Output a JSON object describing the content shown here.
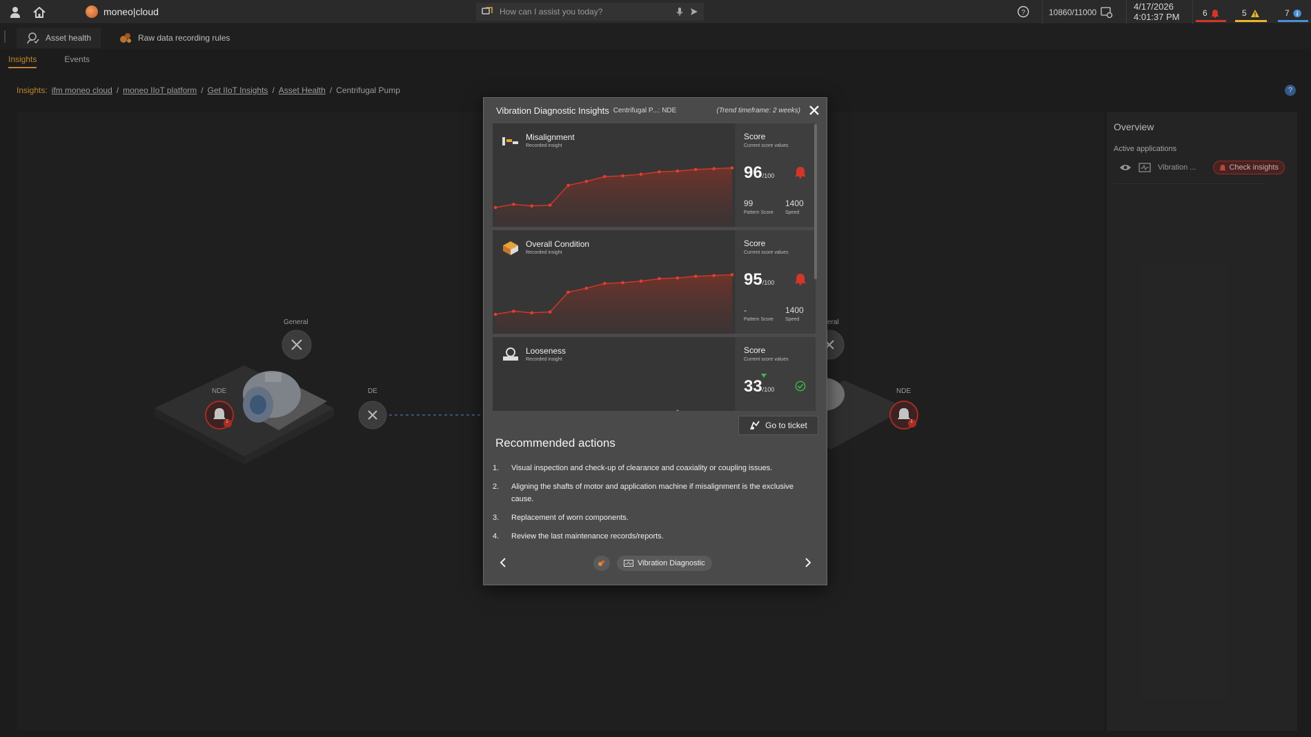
{
  "topbar": {
    "brand": "moneo|cloud",
    "assistant_placeholder": "How can I assist you today?",
    "counter": "10860/11000",
    "date": "4/17/2026",
    "time": "4:01:37 PM",
    "alerts": [
      {
        "count": "6",
        "type": "alarm",
        "color": "#d2362a"
      },
      {
        "count": "5",
        "type": "warning",
        "color": "#e8b82a"
      },
      {
        "count": "7",
        "type": "info",
        "color": "#4a8fd8"
      }
    ]
  },
  "apptabs": [
    {
      "label": "Asset health",
      "icon": "asset-health-icon"
    },
    {
      "label": "Raw data recording rules",
      "icon": "recording-rules-icon"
    }
  ],
  "subtabs": [
    {
      "label": "Insights",
      "active": true
    },
    {
      "label": "Events",
      "active": false
    }
  ],
  "breadcrumb": {
    "lead": "Insights:",
    "links": [
      "ifm moneo cloud",
      "moneo IIoT platform",
      "Get IIoT Insights",
      "Asset Health"
    ],
    "current": "Centrifugal Pump"
  },
  "diagram": {
    "general_label": "General",
    "general_label_right": "eral",
    "nde_left": "NDE",
    "de_left": "DE",
    "nde_right": "NDE",
    "badge_count": "1"
  },
  "overview": {
    "title": "Overview",
    "active_apps_label": "Active applications",
    "app_name": "Vibration ...",
    "check_button": "Check insights"
  },
  "dialog": {
    "title": "Vibration Diagnostic Insights",
    "asset": "Centrifugal P...: NDE",
    "timeframe": "(Trend timeframe: 2 weeks)",
    "cards": [
      {
        "name": "Misalignment",
        "sub": "Recorded insight",
        "icon": "misalignment-icon",
        "score_label": "Score",
        "score_sub": "Current score values",
        "score": "96",
        "max": "/100",
        "state": "alarm",
        "metric1": "99",
        "metric1_label": "Pattern Score",
        "metric2": "1400",
        "metric2_label": "Speed",
        "trend": [
          20,
          24,
          22,
          23,
          48,
          53,
          59,
          60,
          62,
          65,
          66,
          68,
          69,
          70
        ]
      },
      {
        "name": "Overall Condition",
        "sub": "Recorded insight",
        "icon": "overall-condition-icon",
        "score_label": "Score",
        "score_sub": "Current score values",
        "score": "95",
        "max": "/100",
        "state": "alarm",
        "metric1": "-",
        "metric1_label": "Pattern Score",
        "metric2": "1400",
        "metric2_label": "Speed",
        "trend": [
          20,
          24,
          22,
          23,
          48,
          53,
          59,
          60,
          62,
          65,
          66,
          68,
          69,
          70
        ]
      },
      {
        "name": "Looseness",
        "sub": "Recorded insight",
        "icon": "looseness-icon",
        "score_label": "Score",
        "score_sub": "Current score values",
        "score": "33",
        "max": "/100",
        "state": "ok",
        "metric1": "",
        "metric1_label": "",
        "metric2": "",
        "metric2_label": "",
        "trend": []
      }
    ],
    "ticket_button": "Go to ticket",
    "recommended_title": "Recommended actions",
    "actions": [
      "Visual inspection and check-up of clearance and coaxiality or coupling issues.",
      "Aligning the shafts of motor and application machine if misalignment is the exclusive cause.",
      "Replacement of worn components.",
      "Review the last maintenance records/reports."
    ],
    "app_chip": "Vibration Diagnostic"
  }
}
